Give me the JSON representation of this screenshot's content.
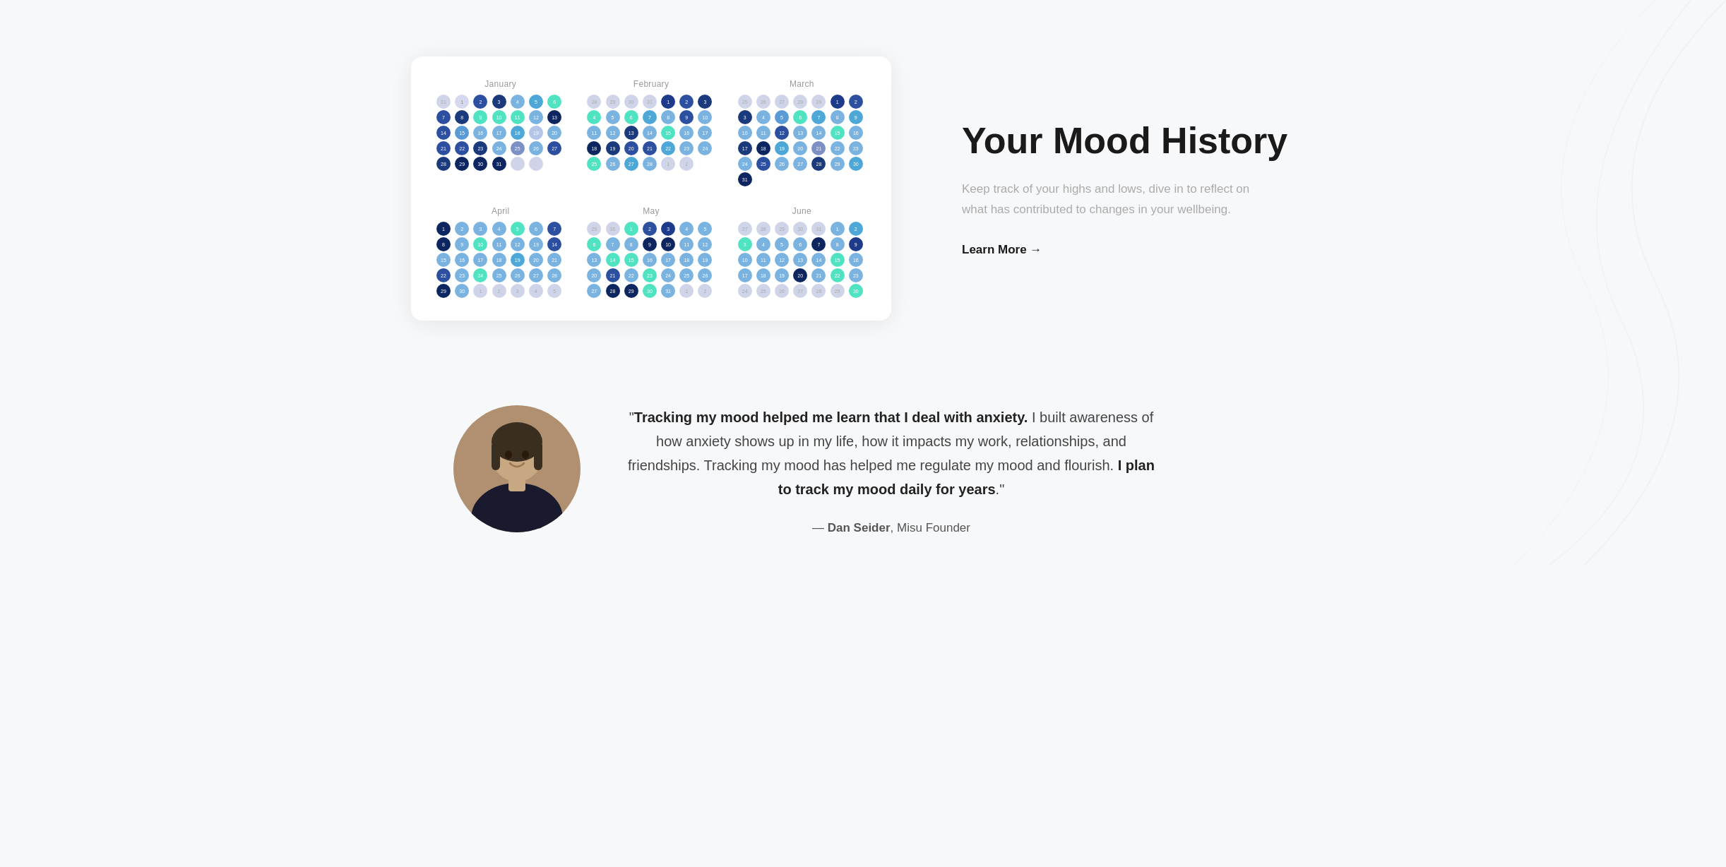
{
  "page": {
    "background": "#f7f8fa"
  },
  "mood_section": {
    "title": "Your Mood History",
    "description": "Keep track of your highs and lows, dive in to reflect on what has contributed to changes in your wellbeing.",
    "learn_more_label": "Learn More →"
  },
  "testimonial": {
    "quote_open": "\"",
    "bold_start": "Tracking my mood helped me learn that I deal with anxiety.",
    "middle_text": " I built awareness of how anxiety shows up in my life, how it impacts my work, relationships, and friendships. Tracking my mood has helped me regulate my mood and flourish. ",
    "bold_end": "I plan to track my mood daily for years",
    "quote_close": ".\"",
    "author_dash": "— ",
    "author_name": "Dan Seider",
    "author_title": ", Misu Founder"
  },
  "calendar": {
    "months": [
      {
        "name": "January"
      },
      {
        "name": "February"
      },
      {
        "name": "March"
      },
      {
        "name": "April"
      },
      {
        "name": "May"
      },
      {
        "name": "June"
      }
    ]
  }
}
